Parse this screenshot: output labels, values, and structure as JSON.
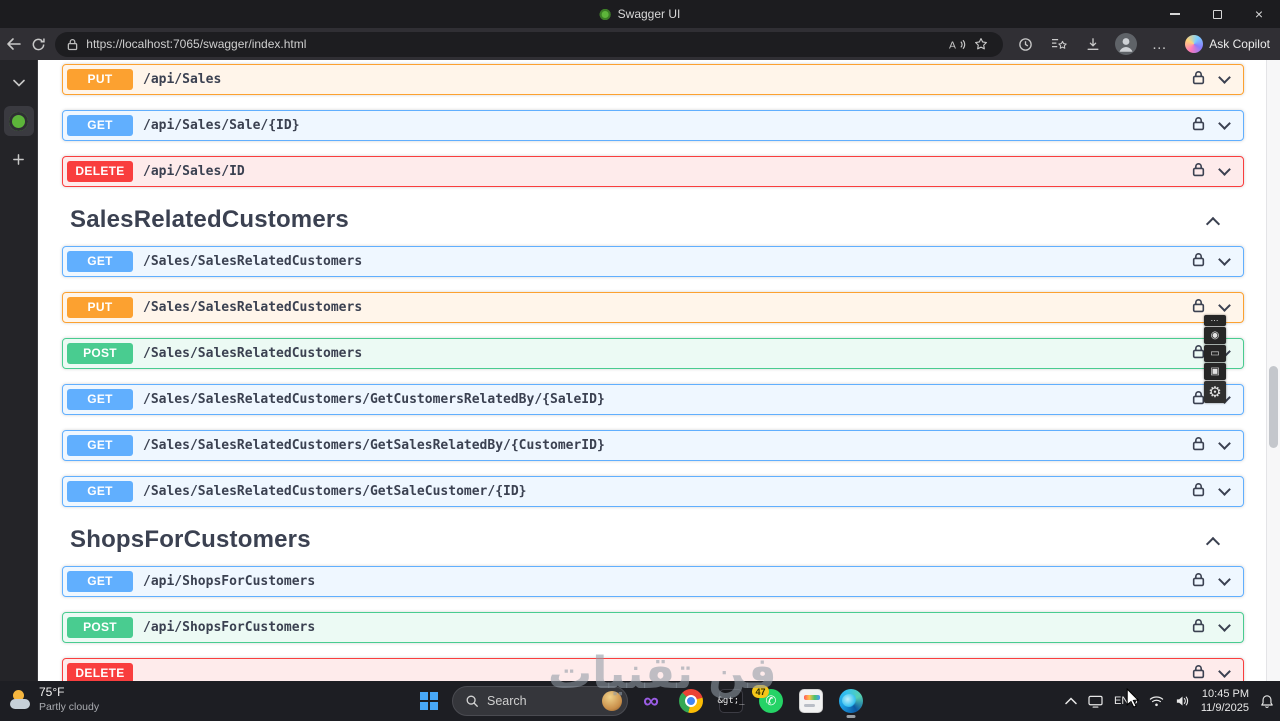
{
  "window": {
    "title": "Swagger UI"
  },
  "browser": {
    "url": "https://localhost:7065/swagger/index.html",
    "copilot_label": "Ask Copilot"
  },
  "api": {
    "method_colors": {
      "GET": "#61affe",
      "POST": "#49cc90",
      "PUT": "#fca130",
      "DELETE": "#f93e3e"
    },
    "sections": [
      {
        "title": "",
        "rows": [
          {
            "method": "PUT",
            "path": "/api/Sales"
          },
          {
            "method": "GET",
            "path": "/api/Sales/Sale/{ID}"
          },
          {
            "method": "DELETE",
            "path": "/api/Sales/ID"
          }
        ]
      },
      {
        "title": "SalesRelatedCustomers",
        "rows": [
          {
            "method": "GET",
            "path": "/Sales/SalesRelatedCustomers"
          },
          {
            "method": "PUT",
            "path": "/Sales/SalesRelatedCustomers"
          },
          {
            "method": "POST",
            "path": "/Sales/SalesRelatedCustomers"
          },
          {
            "method": "GET",
            "path": "/Sales/SalesRelatedCustomers/GetCustomersRelatedBy/{SaleID}"
          },
          {
            "method": "GET",
            "path": "/Sales/SalesRelatedCustomers/GetSalesRelatedBy/{CustomerID}"
          },
          {
            "method": "GET",
            "path": "/Sales/SalesRelatedCustomers/GetSaleCustomer/{ID}"
          }
        ]
      },
      {
        "title": "ShopsForCustomers",
        "rows": [
          {
            "method": "GET",
            "path": "/api/ShopsForCustomers"
          },
          {
            "method": "POST",
            "path": "/api/ShopsForCustomers"
          },
          {
            "method": "DELETE",
            "path": ""
          }
        ]
      }
    ]
  },
  "taskbar": {
    "weather": {
      "temp": "75°F",
      "condition": "Partly cloudy"
    },
    "search_label": "Search",
    "whatsapp_badge": "47",
    "tray": {
      "language": "ENG",
      "time": "10:45 PM",
      "date": "11/9/2025"
    }
  },
  "icons": {
    "close": "×",
    "more": "…",
    "terminal": "&gt;_",
    "infinity": "∞",
    "whatsapp": "✆",
    "capture_handle": "⋯",
    "capture_camera": "◉",
    "capture_screen": "▭",
    "capture_window": "▣",
    "capture_gear": "⚙"
  },
  "watermark": "فن تقنيات"
}
